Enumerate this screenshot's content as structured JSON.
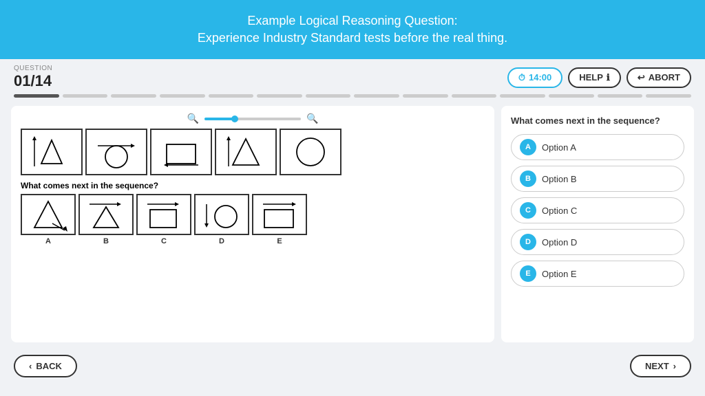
{
  "header": {
    "title_line1": "Example Logical Reasoning Question:",
    "title_line2": "Experience Industry Standard tests before the real thing."
  },
  "question_bar": {
    "label": "QUESTION",
    "number": "01/14",
    "timer_label": "14:00",
    "help_label": "HELP",
    "abort_label": "ABORT"
  },
  "progress": {
    "total": 14,
    "active": 1
  },
  "main": {
    "sequence_question": "What comes next in the sequence?",
    "answer_prompt": "What comes next in the sequence?",
    "options": [
      {
        "letter": "A",
        "label": "Option A"
      },
      {
        "letter": "B",
        "label": "Option B"
      },
      {
        "letter": "C",
        "label": "Option C"
      },
      {
        "letter": "D",
        "label": "Option D"
      },
      {
        "letter": "E",
        "label": "Option E"
      }
    ],
    "answer_letters": [
      "A",
      "B",
      "C",
      "D",
      "E"
    ]
  },
  "footer": {
    "back_label": "BACK",
    "next_label": "NEXT"
  }
}
